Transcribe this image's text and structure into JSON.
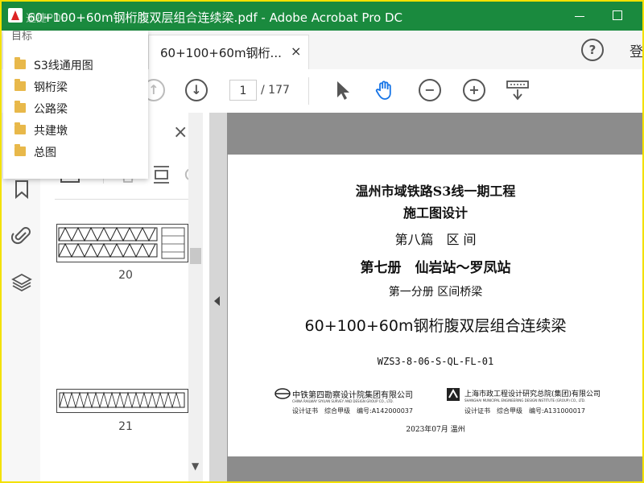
{
  "window": {
    "title": "60+100+60m钢桁腹双层组合连续梁.pdf - Adobe Acrobat Pro DC",
    "watermark": "迅捷PDF"
  },
  "tabs": {
    "doc_tab_label": "60+100+60m钢桁...",
    "doc_tab_close": "×",
    "help": "?",
    "signin": "登"
  },
  "toolbar": {
    "page_current": "1",
    "page_total": "/ 177"
  },
  "bookmarks": {
    "header": "目标",
    "items": [
      {
        "label": "S3线通用图"
      },
      {
        "label": "钢桁梁"
      },
      {
        "label": "公路梁"
      },
      {
        "label": "共建墩"
      },
      {
        "label": "总图"
      }
    ]
  },
  "thumbnails": {
    "close": "×",
    "pages": [
      {
        "label": "20"
      },
      {
        "label": "21"
      }
    ]
  },
  "document": {
    "line1": "温州市域铁路S3线一期工程",
    "line2": "施工图设计",
    "line3": "第八篇　区 间",
    "line4": "第七册　仙岩站～罗凤站",
    "line5": "第一分册 区间桥梁",
    "main_title": "60+100+60m钢桁腹双层组合连续梁",
    "doc_code": "WZS3-8-06-S-QL-FL-01",
    "org1_name": "中铁第四勘察设计院集团有限公司",
    "org1_name_en": "CHINA RAILWAY SIYUAN SURVEY AND DESIGN GROUP CO., LTD.",
    "org1_cert": "设计证书　综合甲级　编号:A142000037",
    "org2_name": "上海市政工程设计研究总院(集团)有限公司",
    "org2_name_en": "SHANGHAI MUNICIPAL ENGINEERING DESIGN INSTITUTE (GROUP) CO., LTD.",
    "org2_cert": "设计证书　综合甲级　编号:A131000017",
    "date": "2023年07月 温州"
  },
  "colors": {
    "titlebar": "#1a8a3e",
    "border_highlight": "#f3e100",
    "folder": "#e8b84a"
  }
}
